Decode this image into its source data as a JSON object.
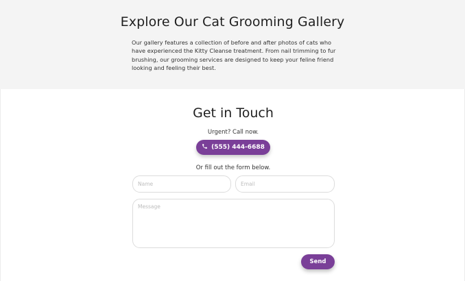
{
  "gallery": {
    "title": "Explore Our Cat Grooming Gallery",
    "description": "Our gallery features a collection of before and after photos of cats who have experienced the Kitty Cleanse treatment. From nail trimming to fur brushing, our grooming services are designed to keep your feline friend looking and feeling their best."
  },
  "contact": {
    "title": "Get in Touch",
    "urgent_text": "Urgent? Call now.",
    "call_button": {
      "label": "(555) 444-6688",
      "icon": "phone-icon"
    },
    "form_hint": "Or fill out the form below.",
    "form": {
      "name_placeholder": "Name",
      "email_placeholder": "Email",
      "message_placeholder": "Message",
      "send_label": "Send"
    }
  },
  "colors": {
    "accent": "#7a3f98",
    "gallery_background": "#f4f4f4"
  }
}
